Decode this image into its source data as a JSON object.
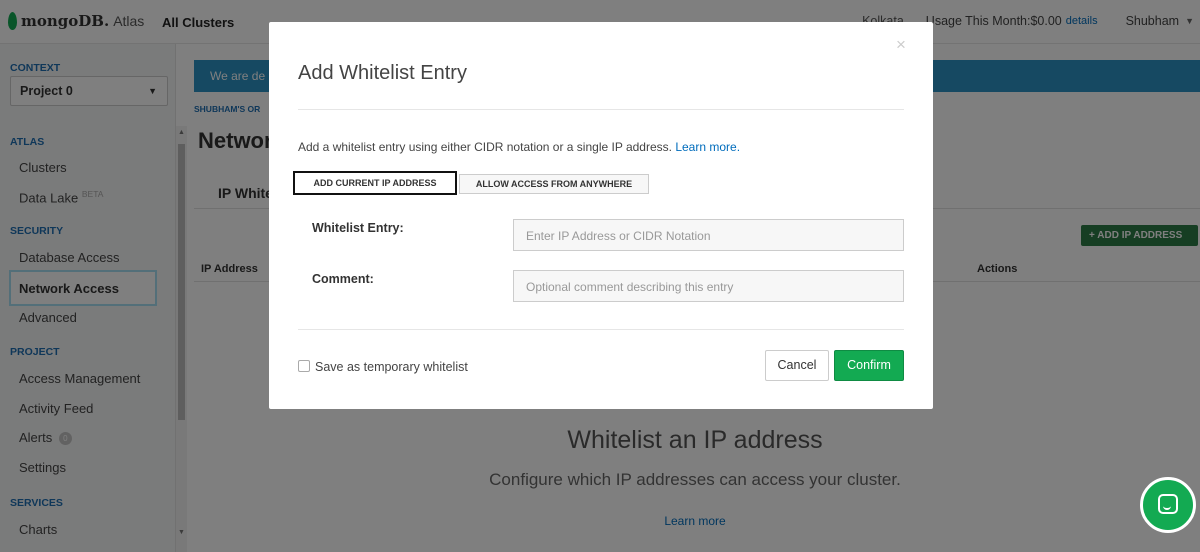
{
  "topbar": {
    "logo_main": "mongoDB.",
    "logo_sub": "Atlas",
    "all_clusters": "All Clusters",
    "region": "Kolkata",
    "usage": "Usage This Month:$0.00",
    "usage_details": "details",
    "user": "Shubham"
  },
  "sidebar": {
    "context_heading": "CONTEXT",
    "project_select": "Project 0",
    "atlas_heading": "ATLAS",
    "clusters": "Clusters",
    "data_lake": "Data Lake",
    "data_lake_badge": "BETA",
    "security_heading": "SECURITY",
    "database_access": "Database Access",
    "network_access": "Network Access",
    "advanced": "Advanced",
    "project_heading": "PROJECT",
    "access_management": "Access Management",
    "activity_feed": "Activity Feed",
    "alerts": "Alerts",
    "alerts_count": "0",
    "settings": "Settings",
    "services_heading": "SERVICES",
    "charts": "Charts"
  },
  "main": {
    "banner": "We are de",
    "breadcrumb": "SHUBHAM'S OR",
    "page_title": "Networ",
    "tab_ip": "IP White",
    "add_ip_button": "+ ADD IP ADDRESS",
    "col_ip": "IP Address",
    "col_actions": "Actions",
    "empty_title": "Whitelist an IP address",
    "empty_sub": "Configure which IP addresses can access your cluster.",
    "empty_link": "Learn more"
  },
  "modal": {
    "close": "×",
    "title": "Add Whitelist Entry",
    "description": "Add a whitelist entry using either CIDR notation or a single IP address.",
    "learn_more": "Learn more.",
    "btn_current_ip": "ADD CURRENT IP ADDRESS",
    "btn_anywhere": "ALLOW ACCESS FROM ANYWHERE",
    "entry_label": "Whitelist Entry:",
    "entry_placeholder": "Enter IP Address or CIDR Notation",
    "comment_label": "Comment:",
    "comment_placeholder": "Optional comment describing this entry",
    "temp_label": "Save as temporary whitelist",
    "cancel": "Cancel",
    "confirm": "Confirm"
  },
  "colors": {
    "accent_green": "#13aa52",
    "link_blue": "#006cbc",
    "banner_blue": "#2d93c5"
  },
  "icons": [
    "leaf-logo-icon",
    "close-icon",
    "chevron-down-icon",
    "chat-icon",
    "scroll-up-icon",
    "scroll-down-icon"
  ]
}
